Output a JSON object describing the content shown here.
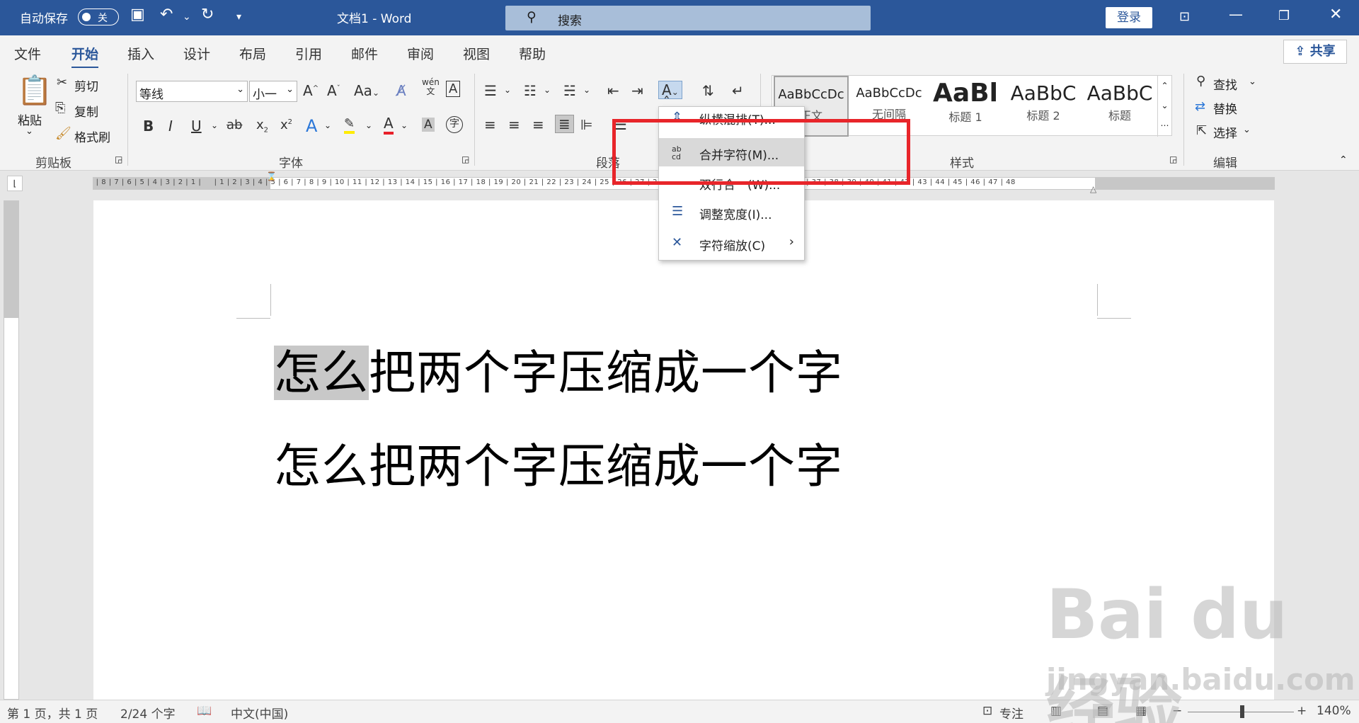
{
  "titlebar": {
    "autosave_label": "自动保存",
    "autosave_state": "关",
    "doc_title": "文档1  -  Word",
    "search_placeholder": "搜索",
    "login_label": "登录"
  },
  "tabs": [
    "文件",
    "开始",
    "插入",
    "设计",
    "布局",
    "引用",
    "邮件",
    "审阅",
    "视图",
    "帮助"
  ],
  "share_label": "共享",
  "ribbon": {
    "clipboard": {
      "paste": "粘贴",
      "cut": "剪切",
      "copy": "复制",
      "format_painter": "格式刷",
      "label": "剪贴板"
    },
    "font": {
      "name": "等线",
      "size": "小一",
      "label": "字体"
    },
    "paragraph": {
      "label": "段落"
    },
    "styles": {
      "label": "样式",
      "items": [
        {
          "preview": "AaBbCcDc",
          "name": "正文"
        },
        {
          "preview": "AaBbCcDc",
          "name": "无间隔"
        },
        {
          "preview": "AaBl",
          "name": "标题 1"
        },
        {
          "preview": "AaBbC",
          "name": "标题 2"
        },
        {
          "preview": "AaBbC",
          "name": "标题"
        }
      ]
    },
    "editing": {
      "find": "查找",
      "replace": "替换",
      "select": "选择",
      "label": "编辑"
    }
  },
  "menu": {
    "items": [
      {
        "icon": "vertical-text-icon",
        "label": "纵横混排(T)..."
      },
      {
        "icon": "combine-chars-icon",
        "label": "合并字符(M)..."
      },
      {
        "icon": "two-lines-icon",
        "label": "双行合一(W)..."
      },
      {
        "icon": "adjust-width-icon",
        "label": "调整宽度(I)..."
      },
      {
        "icon": "char-scale-icon",
        "label": "字符缩放(C)"
      }
    ]
  },
  "document": {
    "line1_highlight": "怎么",
    "line1_rest": "把两个字压缩成一个字",
    "line2": "怎么把两个字压缩成一个字"
  },
  "status": {
    "page": "第 1 页，共 1 页",
    "words": "2/24 个字",
    "lang": "中文(中国)",
    "focus": "专注",
    "zoom": "140%"
  },
  "watermark": {
    "text": "Bai du 经验",
    "url": "jingyan.baidu.com"
  },
  "colors": {
    "brand": "#2b579a",
    "highlight_box": "#e8252a"
  }
}
